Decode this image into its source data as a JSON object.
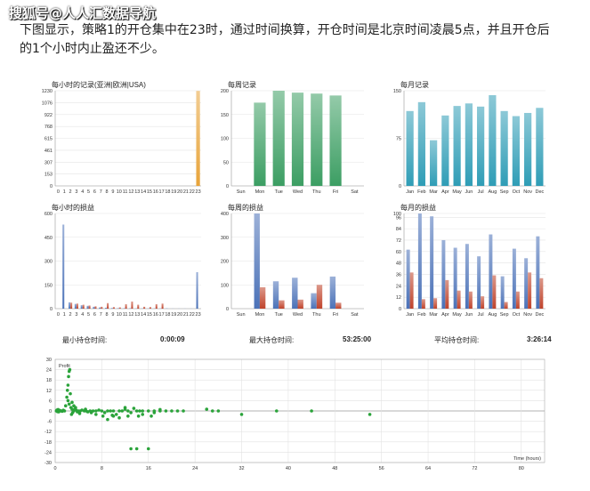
{
  "watermark": "搜狐号@人人汇数据导航",
  "intro": {
    "line1": "下图显示，策略1的开仓集中在23时，通过时间换算，开仓时间是北京时间凌晨5点，并且开仓后",
    "line2": "的1个小时内止盈还不少。"
  },
  "stats": {
    "min_label": "最小持仓时间:",
    "min_value": "0:00:09",
    "max_label": "最大持仓时间:",
    "max_value": "53:25:00",
    "avg_label": "平均持仓时间:",
    "avg_value": "3:26:14"
  },
  "colors": {
    "orange": "#e8a43a",
    "green": "#3c9e63",
    "teal": "#2f9db6",
    "blue": "#4b72b8",
    "red": "#c0432b",
    "scatter": "#2aa33a"
  },
  "chart_data": [
    {
      "id": "hourly-records",
      "type": "bar",
      "title": "每小时的记录(亚洲|欧洲|USA)",
      "categories": [
        "0",
        "1",
        "2",
        "3",
        "4",
        "5",
        "6",
        "7",
        "8",
        "9",
        "10",
        "11",
        "12",
        "13",
        "14",
        "15",
        "16",
        "17",
        "18",
        "19",
        "20",
        "21",
        "22",
        "23"
      ],
      "values": [
        0,
        0,
        0,
        0,
        0,
        0,
        0,
        0,
        0,
        0,
        0,
        0,
        0,
        0,
        0,
        0,
        0,
        0,
        0,
        0,
        0,
        0,
        0,
        1228
      ],
      "yticks": [
        "0",
        "153",
        "307",
        "461",
        "615",
        "768",
        "922",
        "1076",
        "1230"
      ],
      "ylim": [
        0,
        1230
      ],
      "color": "orange"
    },
    {
      "id": "weekly-records",
      "type": "bar",
      "title": "每周记录",
      "categories": [
        "Sun",
        "Mon",
        "Tue",
        "Wed",
        "Thu",
        "Fri",
        "Sat"
      ],
      "values": [
        0,
        175,
        200,
        196,
        194,
        190,
        0
      ],
      "yticks": [
        "0",
        "50",
        "100",
        "150",
        "200"
      ],
      "ylim": [
        0,
        200
      ],
      "color": "green"
    },
    {
      "id": "monthly-records",
      "type": "bar",
      "title": "每月记录",
      "categories": [
        "Jan",
        "Feb",
        "Mar",
        "Apr",
        "May",
        "Jun",
        "Jul",
        "Aug",
        "Sep",
        "Oct",
        "Nov",
        "Dec"
      ],
      "values": [
        118,
        132,
        72,
        111,
        126,
        130,
        125,
        143,
        118,
        110,
        115,
        123
      ],
      "yticks": [
        "0",
        "75",
        "150"
      ],
      "ylim": [
        0,
        150
      ],
      "color": "teal"
    },
    {
      "id": "hourly-pnl",
      "type": "bar",
      "title": "每小时的损益",
      "categories": [
        "0",
        "1",
        "2",
        "3",
        "4",
        "5",
        "6",
        "7",
        "8",
        "9",
        "10",
        "11",
        "12",
        "13",
        "14",
        "15",
        "16",
        "17",
        "18",
        "19",
        "20",
        "21",
        "22",
        "23"
      ],
      "series": [
        {
          "values": [
            0,
            530,
            40,
            30,
            22,
            18,
            12,
            8,
            6,
            4,
            3,
            3,
            3,
            2,
            2,
            2,
            2,
            2,
            2,
            1,
            1,
            1,
            1,
            230
          ],
          "color": "blue"
        },
        {
          "values": [
            0,
            0,
            38,
            32,
            25,
            20,
            15,
            12,
            35,
            10,
            8,
            28,
            45,
            25,
            12,
            10,
            28,
            32,
            0,
            0,
            0,
            0,
            0,
            0
          ],
          "color": "red"
        }
      ],
      "yticks": [
        "0",
        "150",
        "300",
        "450",
        "600"
      ],
      "ylim": [
        0,
        600
      ]
    },
    {
      "id": "weekly-pnl",
      "type": "bar",
      "title": "每周的损益",
      "categories": [
        "Sun",
        "Mon",
        "Tue",
        "Wed",
        "Thu",
        "Fri",
        "Sat"
      ],
      "series": [
        {
          "values": [
            0,
            400,
            115,
            130,
            65,
            135,
            0
          ],
          "color": "blue"
        },
        {
          "values": [
            0,
            90,
            35,
            38,
            100,
            25,
            0
          ],
          "color": "red"
        }
      ],
      "yticks": [
        "0",
        "100",
        "200",
        "300",
        "400"
      ],
      "ylim": [
        0,
        400
      ]
    },
    {
      "id": "monthly-pnl",
      "type": "bar",
      "title": "每月的损益",
      "categories": [
        "Jan",
        "Feb",
        "Mar",
        "Apr",
        "May",
        "Jun",
        "Jul",
        "Aug",
        "Sep",
        "Oct",
        "Nov",
        "Dec"
      ],
      "series": [
        {
          "values": [
            62,
            100,
            97,
            72,
            64,
            68,
            55,
            78,
            34,
            63,
            53,
            76
          ],
          "color": "blue"
        },
        {
          "values": [
            38,
            10,
            11,
            30,
            19,
            18,
            13,
            35,
            7,
            18,
            38,
            32
          ],
          "color": "red"
        }
      ],
      "yticks": [
        "0",
        "12",
        "24",
        "36",
        "48",
        "60",
        "72",
        "84",
        "96",
        "100"
      ],
      "ylim": [
        0,
        100
      ]
    },
    {
      "id": "profit-scatter",
      "type": "scatter",
      "title": "Profit",
      "xlabel": "Time (hours)",
      "xlim": [
        0,
        84
      ],
      "ylim": [
        -30,
        30
      ],
      "xticks": [
        "0",
        "8",
        "16",
        "24",
        "32",
        "40",
        "48",
        "56",
        "64",
        "72",
        "80"
      ],
      "yticks": [
        "30",
        "24",
        "18",
        "12",
        "6",
        "0",
        "-6",
        "-12",
        "-18",
        "-24",
        "-30"
      ],
      "points": [
        [
          0.2,
          0
        ],
        [
          0.3,
          0.5
        ],
        [
          0.4,
          -0.4
        ],
        [
          0.5,
          0.8
        ],
        [
          0.6,
          -0.5
        ],
        [
          0.7,
          0
        ],
        [
          0.8,
          0.3
        ],
        [
          1.0,
          0
        ],
        [
          1.2,
          -0.2
        ],
        [
          1.4,
          0.4
        ],
        [
          1.6,
          0
        ],
        [
          1.8,
          3
        ],
        [
          2.0,
          8
        ],
        [
          2.1,
          12
        ],
        [
          2.2,
          15
        ],
        [
          2.3,
          20
        ],
        [
          2.4,
          23
        ],
        [
          2.5,
          24
        ],
        [
          2.2,
          6
        ],
        [
          2.4,
          4
        ],
        [
          2.6,
          10
        ],
        [
          2.7,
          2
        ],
        [
          2.8,
          -2
        ],
        [
          2.9,
          1
        ],
        [
          3.0,
          -1
        ],
        [
          3.2,
          0
        ],
        [
          3.4,
          1
        ],
        [
          3.6,
          0.5
        ],
        [
          3.8,
          -0.5
        ],
        [
          4.0,
          0
        ],
        [
          4.3,
          0
        ],
        [
          4.6,
          0.5
        ],
        [
          5.0,
          0
        ],
        [
          5.3,
          0
        ],
        [
          5.6,
          -0.5
        ],
        [
          6.0,
          0
        ],
        [
          6.5,
          0
        ],
        [
          7.0,
          0
        ],
        [
          7.5,
          0.5
        ],
        [
          8.0,
          0
        ],
        [
          8.5,
          -1
        ],
        [
          9.0,
          0
        ],
        [
          9.5,
          0
        ],
        [
          10.0,
          0
        ],
        [
          10.5,
          -2
        ],
        [
          11,
          0
        ],
        [
          11.5,
          0
        ],
        [
          12,
          1
        ],
        [
          12.5,
          0
        ],
        [
          13,
          -1
        ],
        [
          14,
          0
        ],
        [
          14.5,
          0
        ],
        [
          15,
          0
        ],
        [
          16,
          0
        ],
        [
          17,
          0
        ],
        [
          18,
          0
        ],
        [
          19,
          0
        ],
        [
          20,
          0
        ],
        [
          21,
          0
        ],
        [
          22,
          0
        ],
        [
          8.2,
          -3
        ],
        [
          9,
          -5
        ],
        [
          10,
          -3
        ],
        [
          11,
          -4
        ],
        [
          12.5,
          -3
        ],
        [
          14.3,
          -3
        ],
        [
          16.5,
          -3
        ],
        [
          13,
          -22
        ],
        [
          14,
          -22
        ],
        [
          16,
          -22
        ],
        [
          7,
          -2
        ],
        [
          9.8,
          -2.5
        ],
        [
          12,
          2
        ],
        [
          13.5,
          1.5
        ],
        [
          15,
          -2
        ],
        [
          17,
          -1
        ],
        [
          18,
          0.8
        ],
        [
          26,
          1
        ],
        [
          27,
          0
        ],
        [
          28,
          0
        ],
        [
          32,
          -2
        ],
        [
          38,
          0
        ],
        [
          44,
          0
        ],
        [
          54,
          -2
        ],
        [
          3.2,
          3
        ],
        [
          3.5,
          2
        ],
        [
          2.9,
          5
        ],
        [
          4.2,
          -1.5
        ],
        [
          5.2,
          1
        ],
        [
          6.2,
          -1
        ]
      ],
      "color": "scatter"
    }
  ]
}
